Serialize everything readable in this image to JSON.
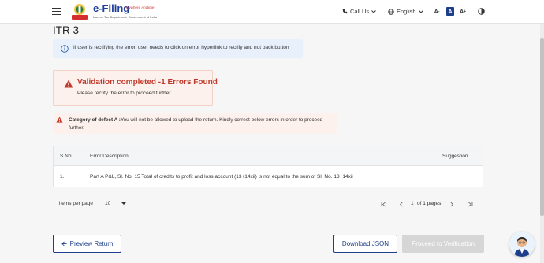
{
  "header": {
    "logo_title": "e-Filing",
    "logo_tagline": "Anywhere Anytime",
    "logo_subtitle": "Income Tax Department, Government of India",
    "call_us": "Call Us",
    "language": "English",
    "font_decrease": "A",
    "font_normal": "A",
    "font_increase": "A"
  },
  "page": {
    "title": "ITR 3"
  },
  "info_banner": {
    "text": "If user is rectifying the error, user needs to click on error hyperlink to rectify and not back button"
  },
  "validation": {
    "title": "Validation completed -1  Errors Found",
    "subtitle": "Please rectify the error to proceed further"
  },
  "defect": {
    "category": "Category of defect A :",
    "message": "You will not be allowed to upload the return. Kindly correct below errors in order to proceed further."
  },
  "table": {
    "headers": {
      "sno": "S.No.",
      "description": "Error Description",
      "suggestion": "Suggestion"
    },
    "rows": [
      {
        "sno": "1.",
        "description": "Part A P&L, Sl. No. 15 Total of credits to profit and loss account (13+14xii) is not equal to the sum of Sl. No. 13+14xii",
        "suggestion": ""
      }
    ]
  },
  "pagination": {
    "items_per_page_label": "items per page",
    "items_per_page_value": "10",
    "current_page": "1",
    "of_pages": "of 1 pages"
  },
  "actions": {
    "preview": "Preview Return",
    "download": "Download JSON",
    "proceed": "Proceed to Verification"
  },
  "colors": {
    "primary": "#1d3e8a",
    "error": "#c0392b",
    "error_bg": "#fdf1ed",
    "info_bg": "#e8f1fb",
    "disabled": "#d6d6d6"
  }
}
